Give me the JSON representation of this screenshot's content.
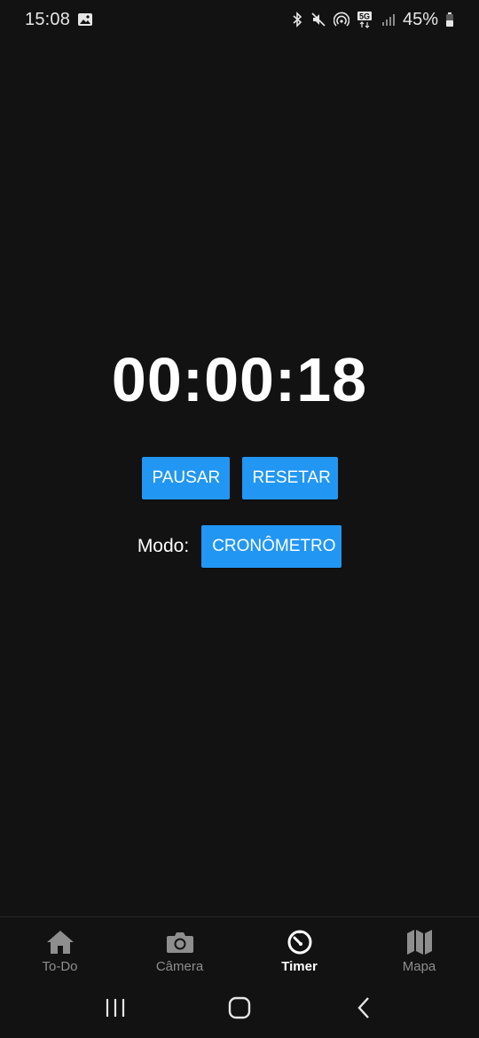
{
  "status_bar": {
    "time": "15:08",
    "battery_percent": "45%",
    "network": "5G",
    "icons": [
      "gallery-icon",
      "bluetooth-icon",
      "mute-icon",
      "hotspot-icon",
      "5g-icon",
      "signal-icon",
      "battery-icon"
    ]
  },
  "timer": {
    "display": "00:00:18"
  },
  "controls": {
    "pause_label": "PAUSAR",
    "reset_label": "RESETAR",
    "mode_label": "Modo:",
    "mode_value": "CRONÔMETRO"
  },
  "bottom_nav": {
    "items": [
      {
        "label": "To-Do",
        "icon": "home-icon",
        "active": false
      },
      {
        "label": "Câmera",
        "icon": "camera-icon",
        "active": false
      },
      {
        "label": "Timer",
        "icon": "timer-icon",
        "active": true
      },
      {
        "label": "Mapa",
        "icon": "map-icon",
        "active": false
      }
    ]
  },
  "colors": {
    "background": "#121212",
    "accent": "#2196f3",
    "text": "#ffffff",
    "inactive": "#8e8e8e"
  }
}
